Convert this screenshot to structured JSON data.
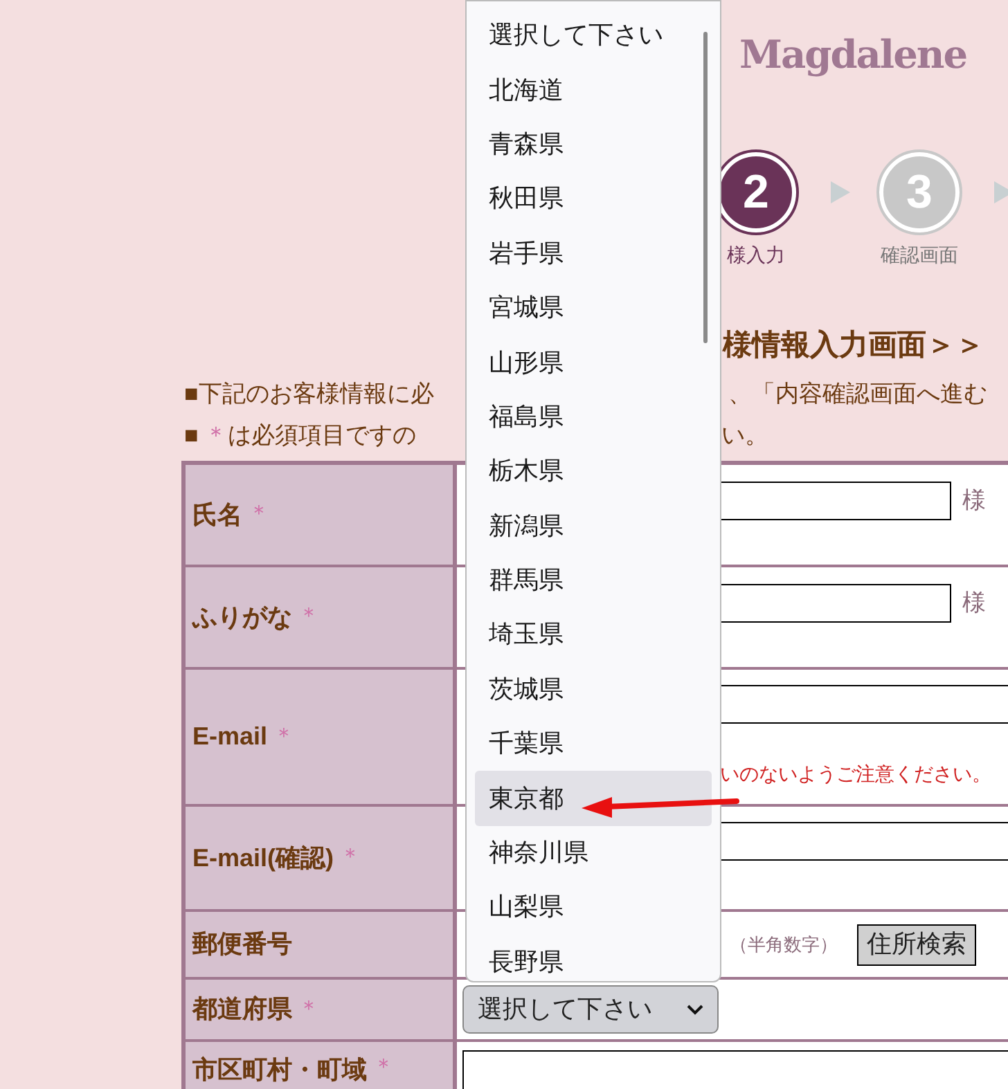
{
  "header": {
    "logo": "Magdalene",
    "steps": [
      {
        "number": "2",
        "label": "様入力",
        "selected": true
      },
      {
        "number": "3",
        "label": "確認画面",
        "selected": false
      }
    ]
  },
  "page_title": "様情報入力画面＞＞",
  "required_mark": "＊",
  "notes": [
    {
      "bullet": "■",
      "required": false,
      "text": "下記のお客様情報に必",
      "continued": "、「内容確認画面へ進む"
    },
    {
      "bullet": "■",
      "required": true,
      "text": "は必須項目ですの",
      "continued": "い。"
    }
  ],
  "rows": [
    {
      "label": "氏名",
      "required": true,
      "kind": "name",
      "suffix": "様"
    },
    {
      "label": "ふりがな",
      "required": true,
      "kind": "name",
      "suffix": "様"
    },
    {
      "label": "E-mail",
      "required": true,
      "kind": "email",
      "note": "いのないようご注意ください。"
    },
    {
      "label": "E-mail(確認)",
      "required": true,
      "kind": "email"
    },
    {
      "label": "郵便番号",
      "required": false,
      "kind": "zip",
      "hint": "（半角数字）",
      "button": "住所検索"
    },
    {
      "label": "都道府県",
      "required": true,
      "kind": "select",
      "value": "選択して下さい"
    },
    {
      "label": "市区町村・町域",
      "required": true,
      "kind": "text"
    }
  ],
  "dropdown": {
    "options": [
      {
        "label": "選択して下さい",
        "selected": false
      },
      {
        "label": "北海道",
        "selected": false
      },
      {
        "label": "青森県",
        "selected": false
      },
      {
        "label": "秋田県",
        "selected": false
      },
      {
        "label": "岩手県",
        "selected": false
      },
      {
        "label": "宮城県",
        "selected": false
      },
      {
        "label": "山形県",
        "selected": false
      },
      {
        "label": "福島県",
        "selected": false
      },
      {
        "label": "栃木県",
        "selected": false
      },
      {
        "label": "新潟県",
        "selected": false
      },
      {
        "label": "群馬県",
        "selected": false
      },
      {
        "label": "埼玉県",
        "selected": false
      },
      {
        "label": "茨城県",
        "selected": false
      },
      {
        "label": "千葉県",
        "selected": false
      },
      {
        "label": "東京都",
        "selected": true
      },
      {
        "label": "神奈川県",
        "selected": false
      },
      {
        "label": "山梨県",
        "selected": false
      },
      {
        "label": "長野県",
        "selected": false
      }
    ]
  }
}
